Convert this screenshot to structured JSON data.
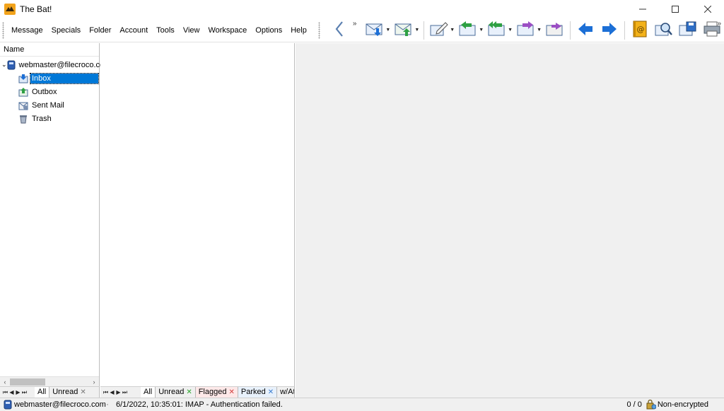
{
  "window": {
    "title": "The Bat!",
    "controls": {
      "minimize": "—",
      "maximize": "☐",
      "close": "✕"
    }
  },
  "menu": {
    "items": [
      "Message",
      "Specials",
      "Folder",
      "Account",
      "Tools",
      "View",
      "Workspace",
      "Options",
      "Help"
    ],
    "overflow": "»"
  },
  "toolbar": {
    "overflow": "»",
    "buttons": [
      "back-icon",
      "get-mail-icon",
      "send-mail-icon",
      "new-message-icon",
      "reply-icon",
      "reply-all-icon",
      "forward-icon",
      "redirect-icon",
      "previous-message-icon",
      "next-message-icon",
      "address-book-icon",
      "find-icon",
      "save-icon",
      "print-icon"
    ]
  },
  "folders": {
    "header": "Name",
    "account": "webmaster@filecroco.co",
    "items": [
      {
        "label": "Inbox",
        "icon": "inbox-icon",
        "selected": true
      },
      {
        "label": "Outbox",
        "icon": "outbox-icon",
        "selected": false
      },
      {
        "label": "Sent Mail",
        "icon": "sent-mail-icon",
        "selected": false
      },
      {
        "label": "Trash",
        "icon": "trash-icon",
        "selected": false
      }
    ]
  },
  "folder_tabs": {
    "all": "All",
    "unread": "Unread"
  },
  "list_tabs": {
    "all": "All",
    "unread": "Unread",
    "flagged": "Flagged",
    "parked": "Parked",
    "attachments": "w/At"
  },
  "status": {
    "account": "webmaster@filecroco.com",
    "separator": "·",
    "log": "6/1/2022, 10:35:01: IMAP  - Authentication failed.",
    "count": "0 / 0",
    "encryption": "Non-encrypted"
  },
  "colors": {
    "selection": "#0078d7",
    "accent_blue": "#1c6fd6",
    "accent_green": "#2ea043",
    "accent_purple": "#9b4fc4"
  }
}
